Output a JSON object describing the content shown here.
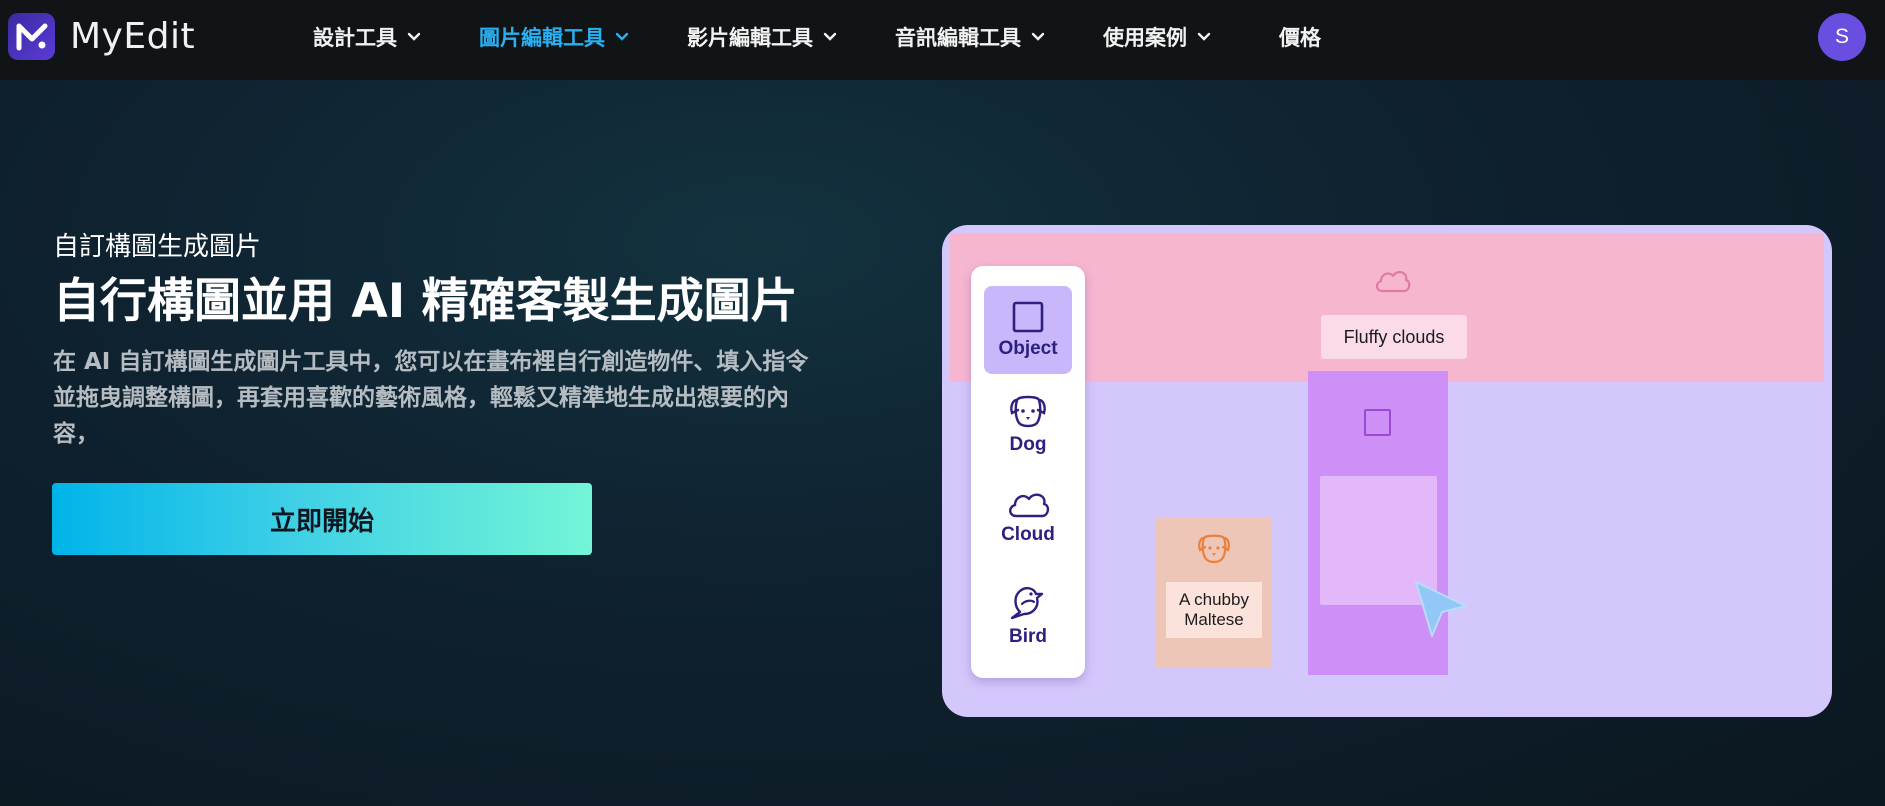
{
  "app": {
    "name": "MyEdit",
    "logo_letter": "M"
  },
  "nav": {
    "items": [
      {
        "label": "設計工具",
        "has_dropdown": true,
        "active": false
      },
      {
        "label": "圖片編輯工具",
        "has_dropdown": true,
        "active": true
      },
      {
        "label": "影片編輯工具",
        "has_dropdown": true,
        "active": false
      },
      {
        "label": "音訊編輯工具",
        "has_dropdown": true,
        "active": false
      },
      {
        "label": "使用案例",
        "has_dropdown": true,
        "active": false
      },
      {
        "label": "價格",
        "has_dropdown": false,
        "active": false
      }
    ],
    "avatar_initial": "S",
    "active_color": "#2ab0f0"
  },
  "hero": {
    "subtitle": "自訂構圖生成圖片",
    "title": "自行構圖並用 AI 精確客製生成圖片",
    "description_lines": [
      "在 AI 自訂構圖生成圖片工具中，您可以在畫布裡自行創造物件、填入指令",
      "並拖曳調整構圖，再套用喜歡的藝術風格，輕鬆又精準地生成出想要的內",
      "容，"
    ],
    "cta_label": "立即開始"
  },
  "illustration": {
    "palette": [
      {
        "label": "Object",
        "icon": "square-icon",
        "selected": true
      },
      {
        "label": "Dog",
        "icon": "dog-icon",
        "selected": false
      },
      {
        "label": "Cloud",
        "icon": "cloud-icon",
        "selected": false
      },
      {
        "label": "Bird",
        "icon": "bird-icon",
        "selected": false
      }
    ],
    "sky_label": "Fluffy clouds",
    "dog_label_line1": "A chubby",
    "dog_label_line2": "Maltese",
    "colors": {
      "canvas": "#d4c7fb",
      "sky": "#f6b6d0",
      "object": "#ce8ff6",
      "dog": "#edc6b8"
    }
  }
}
